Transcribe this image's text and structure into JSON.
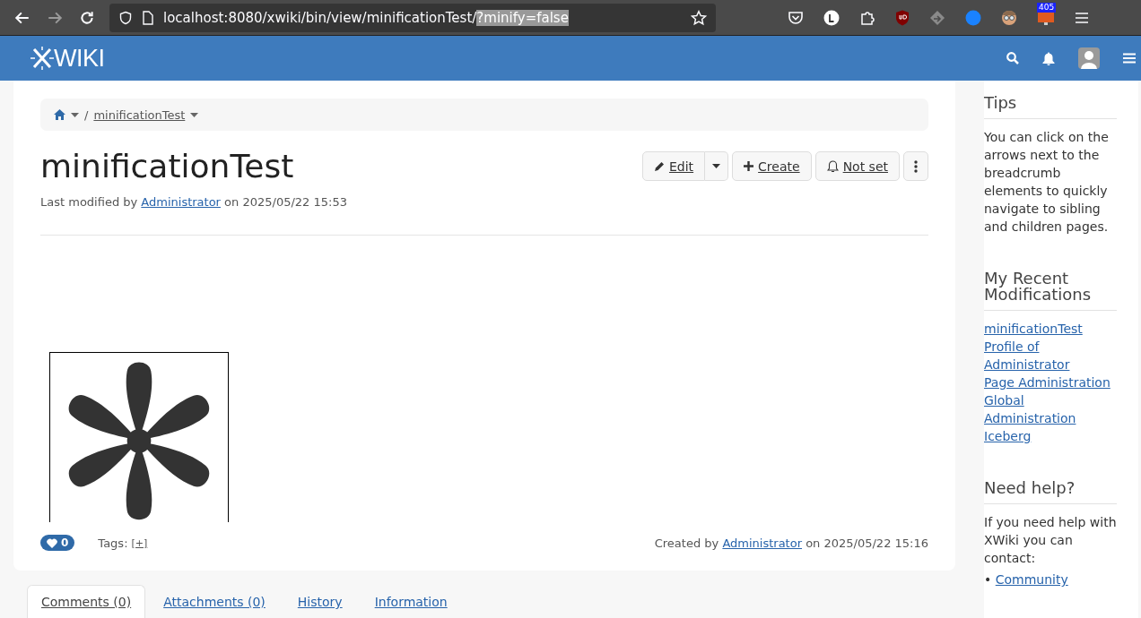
{
  "browser": {
    "url": "localhost:8080/xwiki/bin/view/minificationTest/",
    "url_highlighted": "?minify=false",
    "extension_badge": "405"
  },
  "header": {
    "logo": "WIKI"
  },
  "breadcrumb": [
    {
      "separator": "/",
      "label": "minificationTest"
    }
  ],
  "page": {
    "title": "minificationTest",
    "modified_prefix": "Last modified by",
    "modified_user": "Administrator",
    "modified_suffix": "on 2025/05/22 15:53"
  },
  "actions": [
    {
      "kind": "edit",
      "label": "Edit"
    },
    {
      "kind": "create",
      "label": "Create"
    },
    {
      "kind": "watch",
      "label": "Not set"
    }
  ],
  "footer": {
    "likes": "0",
    "tags_label": "Tags:",
    "tags_add": "[+]",
    "created_prefix": "Created by",
    "created_user": "Administrator",
    "created_suffix": "on 2025/05/22 15:16"
  },
  "tabs": [
    {
      "label": "Comments (0)",
      "selected": true
    },
    {
      "label": "Attachments (0)",
      "selected": false
    },
    {
      "label": "History",
      "selected": false
    },
    {
      "label": "Information",
      "selected": false
    }
  ],
  "sidebar": [
    {
      "kind": "text",
      "title": "Tips",
      "text": "You can click on the arrows next to the breadcrumb elements to quickly navigate to sibling and children pages."
    },
    {
      "kind": "links",
      "title": "My Recent Modifications",
      "links": [
        "minificationTest",
        "Profile of Administrator",
        "Page Administration",
        "Global Administration",
        "Iceberg"
      ]
    },
    {
      "kind": "help",
      "title": "Need help?",
      "text": "If you need help with XWiki you can contact:",
      "bullet": "•",
      "links": [
        "Community"
      ]
    }
  ]
}
